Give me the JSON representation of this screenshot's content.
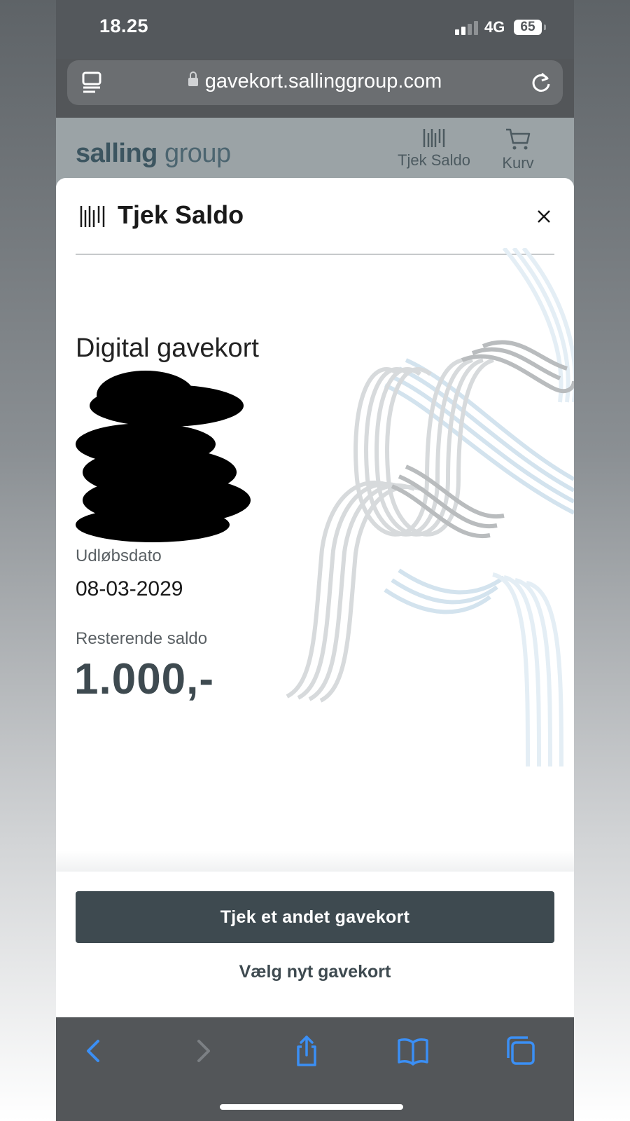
{
  "status_bar": {
    "time": "18.25",
    "network": "4G",
    "battery": "65"
  },
  "browser": {
    "url": "gavekort.sallinggroup.com"
  },
  "site_header": {
    "logo_bold": "salling",
    "logo_light": "group",
    "nav": [
      {
        "label": "Tjek Saldo",
        "icon": "barcode-icon"
      },
      {
        "label": "Kurv",
        "icon": "cart-icon"
      }
    ]
  },
  "modal": {
    "title": "Tjek Saldo",
    "card_type": "Digital gavekort",
    "expiry_label": "Udløbsdato",
    "expiry_value": "08-03-2029",
    "balance_label": "Resterende saldo",
    "balance_value": "1.000,-",
    "primary_button": "Tjek et andet gavekort",
    "secondary_button": "Vælg nyt gavekort"
  },
  "colors": {
    "brand_dark": "#3e4a50",
    "overlay": "#9ba3a6",
    "browser_chrome": "#54585c"
  }
}
